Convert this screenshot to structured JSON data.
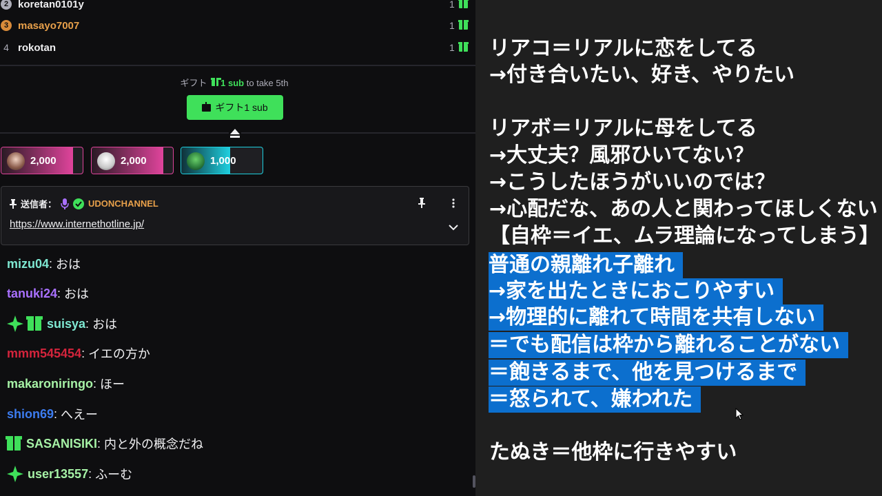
{
  "leaderboard": {
    "rows": [
      {
        "rank": "2",
        "name": "koretan0101y",
        "count": "1",
        "color": "#efeff1",
        "badge_color": "#adadb8"
      },
      {
        "rank": "3",
        "name": "masayo7007",
        "count": "1",
        "color": "#e8a04a",
        "badge_color": "#d98b3a"
      },
      {
        "rank": "4",
        "name": "rokotan",
        "count": "1",
        "color": "#efeff1",
        "badge_color": ""
      }
    ]
  },
  "gift_prompt": {
    "prefix": "ギフト",
    "bold": "1 sub",
    "suffix": "to take 5th",
    "button_label": "ギフト1 sub"
  },
  "hype_train": [
    {
      "amount": "2,000",
      "accent": "#e0449c",
      "fill_pct": 88
    },
    {
      "amount": "2,000",
      "accent": "#e0449c",
      "fill_pct": 88
    },
    {
      "amount": "1,000",
      "accent": "#1ed0e0",
      "fill_pct": 60
    }
  ],
  "pinned": {
    "label": "送信者：",
    "sender": "UDONCHANNEL",
    "url": "https://www.internethotline.jp/"
  },
  "messages": [
    {
      "user": "mizu04",
      "text": "おは",
      "color": "#7ee8d2",
      "badges": []
    },
    {
      "user": "tanuki24",
      "text": "おは",
      "color": "#a970ff",
      "badges": []
    },
    {
      "user": "suisya",
      "text": "おは",
      "color": "#7ee8d2",
      "badges": [
        "sparkle-icon",
        "gift-badge-icon"
      ]
    },
    {
      "user": "mmm545454",
      "text": "イエの方か",
      "color": "#d4243c",
      "badges": []
    },
    {
      "user": "makaroniringo",
      "text": "ほー",
      "color": "#a6f2a6",
      "badges": []
    },
    {
      "user": "shion69",
      "text": "へえー",
      "color": "#3c7cf0",
      "badges": []
    },
    {
      "user": "SASANISIKI",
      "text": "内と外の概念だね",
      "color": "#a6f2a6",
      "badges": [
        "gift-badge-icon"
      ]
    },
    {
      "user": "user13557",
      "text": "ふーむ",
      "color": "#a6f2a6",
      "badges": [
        "sparkle-icon"
      ]
    }
  ],
  "notes": {
    "lines": [
      {
        "text": "リアコ＝リアルに恋をしてる",
        "selected": false
      },
      {
        "text": "→付き合いたい、好き、やりたい",
        "selected": false
      },
      {
        "text": "リアボ＝リアルに母をしてる",
        "selected": false
      },
      {
        "text": "→大丈夫？風邪ひいてない？",
        "selected": false
      },
      {
        "text": "→こうしたほうがいいのでは？",
        "selected": false
      },
      {
        "text": "→心配だな、あの人と関わってほしくない",
        "selected": false
      },
      {
        "text": "【自枠＝イエ、ムラ理論になってしまう】",
        "selected": false
      },
      {
        "text": "普通の親離れ子離れ",
        "selected": true
      },
      {
        "text": "→家を出たときにおこりやすい",
        "selected": true
      },
      {
        "text": "→物理的に離れて時間を共有しない",
        "selected": true
      },
      {
        "text": "＝でも配信は枠から離れることがない",
        "selected": true
      },
      {
        "text": "＝飽きるまで、他を見つけるまで",
        "selected": true
      },
      {
        "text": "＝怒られて、嫌われた",
        "selected": true
      },
      {
        "text": "たぬき＝他枠に行きやすい",
        "selected": false
      }
    ]
  }
}
